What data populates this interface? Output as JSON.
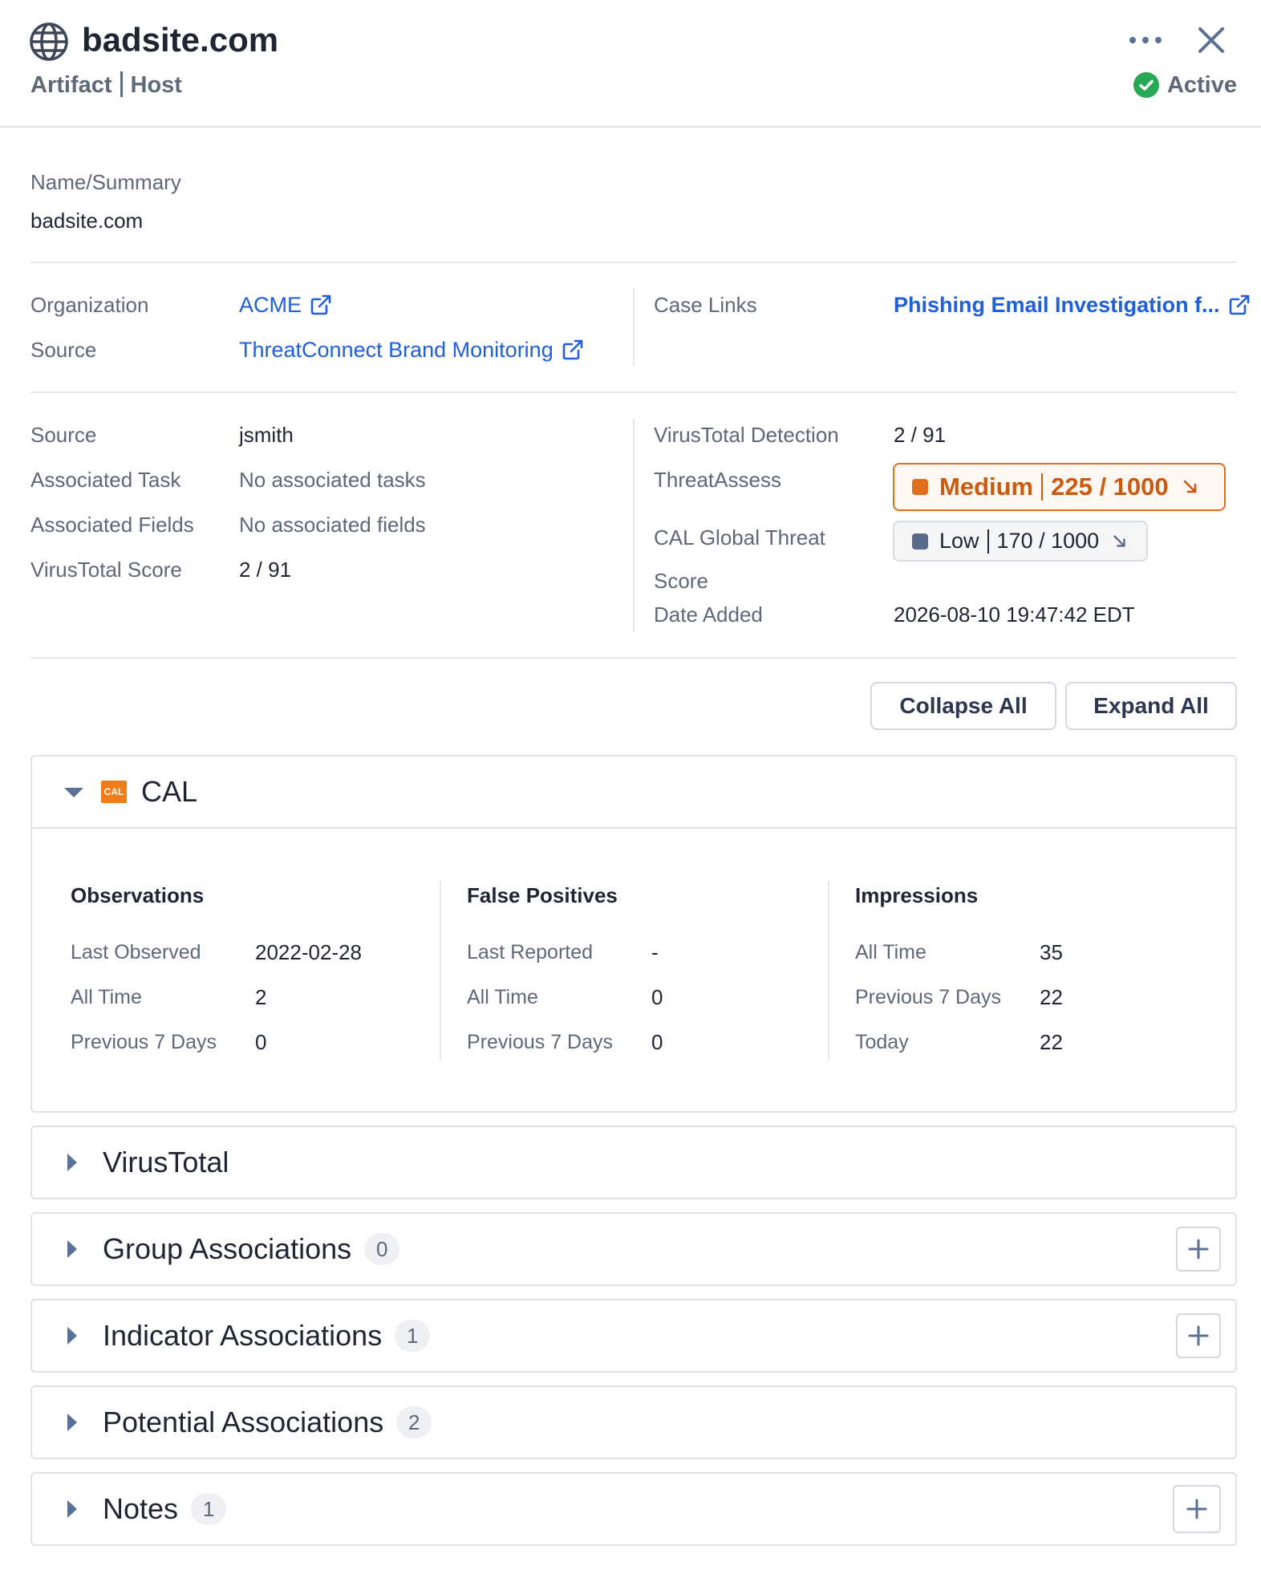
{
  "header": {
    "title": "badsite.com",
    "type": "Artifact",
    "subtype": "Host",
    "status": "Active",
    "icon": "globe-icon"
  },
  "summary": {
    "label": "Name/Summary",
    "value": "badsite.com"
  },
  "links": {
    "organization_label": "Organization",
    "organization_value": "ACME",
    "source_label": "Source",
    "source_value": "ThreatConnect Brand Monitoring",
    "case_links_label": "Case Links",
    "case_links_value": "Phishing Email Investigation f..."
  },
  "details": {
    "left": [
      {
        "label": "Source",
        "value": "jsmith"
      },
      {
        "label": "Associated Task",
        "value": "No associated tasks"
      },
      {
        "label": "Associated Fields",
        "value": "No associated fields"
      },
      {
        "label": "VirusTotal Score",
        "value": "2 / 91"
      }
    ],
    "right": {
      "vt_detection_label": "VirusTotal Detection",
      "vt_detection_value": "2 / 91",
      "threatassess_label": "ThreatAssess",
      "threatassess_level": "Medium",
      "threatassess_score": "225 / 1000",
      "cal_label_line1": "CAL Global Threat",
      "cal_label_line2": "Score",
      "cal_level": "Low",
      "cal_score": "170 / 1000",
      "date_added_label": "Date Added",
      "date_added_value": "2026-08-10 19:47:42 EDT"
    }
  },
  "actions": {
    "collapse_all": "Collapse All",
    "expand_all": "Expand All"
  },
  "cal": {
    "logo_text": "CAL",
    "title": "CAL",
    "observations": {
      "title": "Observations",
      "rows": [
        {
          "label": "Last Observed",
          "value": "2022-02-28"
        },
        {
          "label": "All Time",
          "value": "2"
        },
        {
          "label": "Previous 7 Days",
          "value": "0"
        }
      ]
    },
    "false_positives": {
      "title": "False Positives",
      "rows": [
        {
          "label": "Last Reported",
          "value": "-"
        },
        {
          "label": "All Time",
          "value": "0"
        },
        {
          "label": "Previous 7 Days",
          "value": "0"
        }
      ]
    },
    "impressions": {
      "title": "Impressions",
      "rows": [
        {
          "label": "All Time",
          "value": "35"
        },
        {
          "label": "Previous 7 Days",
          "value": "22"
        },
        {
          "label": "Today",
          "value": "22"
        }
      ]
    }
  },
  "sections": [
    {
      "title": "VirusTotal",
      "count": null
    },
    {
      "title": "Group Associations",
      "count": "0"
    },
    {
      "title": "Indicator Associations",
      "count": "1"
    },
    {
      "title": "Potential Associations",
      "count": "2"
    },
    {
      "title": "Notes",
      "count": "1"
    }
  ],
  "colors": {
    "accent_link": "#1f5fdc",
    "medium": "#e07020",
    "low": "#5a6a8a",
    "active": "#27a855",
    "cal_logo": "#f07c1a"
  }
}
